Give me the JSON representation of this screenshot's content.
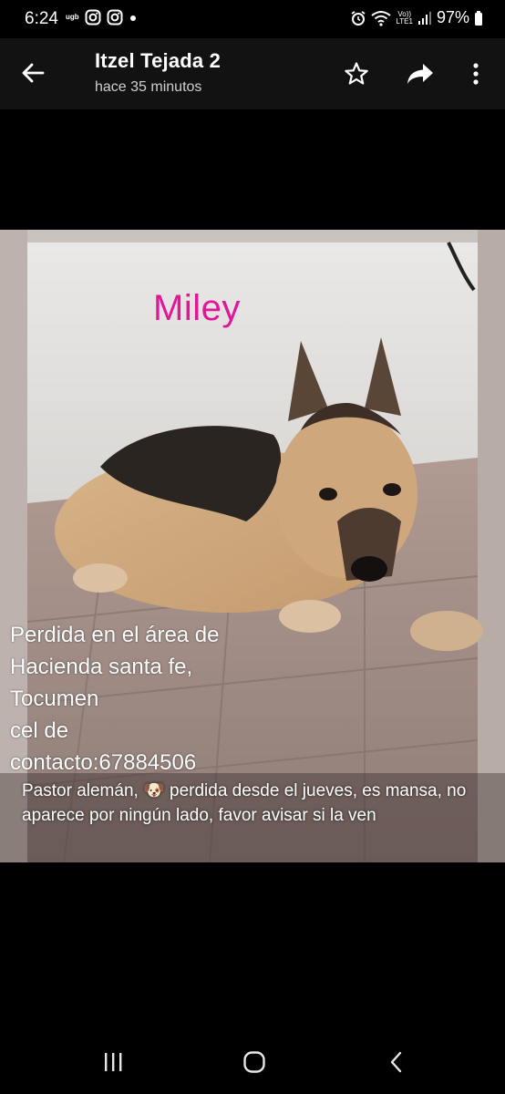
{
  "status_bar": {
    "time": "6:24",
    "carrier_badge": "ugb",
    "volte_top": "Vo))",
    "volte_bottom": "LTE1",
    "battery": "97%"
  },
  "header": {
    "title": "Itzel Tejada 2",
    "subtitle": "hace 35 minutos",
    "icons": [
      "back-arrow-icon",
      "star-icon",
      "share-icon",
      "more-vert-icon"
    ]
  },
  "post": {
    "image_title": "Miley",
    "overlay_lines": [
      "Perdida en el área de",
      "Hacienda santa fe,",
      "Tocumen",
      "cel de",
      "contacto:67884506"
    ],
    "caption": "Pastor alemán, 🐶 perdida desde el jueves, es mansa, no aparece por ningún lado, favor avisar si la ven"
  },
  "navbar": {
    "icons": [
      "recent-apps-icon",
      "home-icon",
      "back-icon"
    ]
  },
  "colors": {
    "background": "#000000",
    "app_bar": "#121212",
    "image_title": "#e1179a"
  }
}
